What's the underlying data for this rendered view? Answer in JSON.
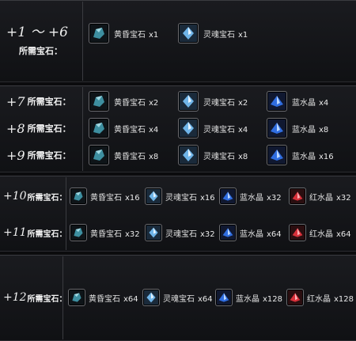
{
  "gem_names": {
    "huanghun": "黄昏宝石",
    "linghun": "灵魂宝石",
    "lanshuijing": "蓝水晶",
    "hongshuijing": "红水晶"
  },
  "colors": {
    "huanghun": "#3d8fa0",
    "linghun": "#6fb4e8",
    "lanshuijing": "#2f6de0",
    "hongshuijing": "#d8303a"
  },
  "section1": {
    "level": "+1 ～ +6",
    "req": "所需宝石："
  },
  "section1_items": [
    {
      "name": "黄昏宝石",
      "qty": "x1"
    },
    {
      "name": "灵魂宝石",
      "qty": "x1"
    }
  ],
  "section2": [
    {
      "level": "+7",
      "req": "所需宝石：",
      "items": [
        {
          "name": "黄昏宝石",
          "qty": "x2"
        },
        {
          "name": "灵魂宝石",
          "qty": "x2"
        },
        {
          "name": "蓝水晶",
          "qty": "x4"
        }
      ]
    },
    {
      "level": "+8",
      "req": "所需宝石：",
      "items": [
        {
          "name": "黄昏宝石",
          "qty": "x4"
        },
        {
          "name": "灵魂宝石",
          "qty": "x4"
        },
        {
          "name": "蓝水晶",
          "qty": "x8"
        }
      ]
    },
    {
      "level": "+9",
      "req": "所需宝石：",
      "items": [
        {
          "name": "黄昏宝石",
          "qty": "x8"
        },
        {
          "name": "灵魂宝石",
          "qty": "x8"
        },
        {
          "name": "蓝水晶",
          "qty": "x16"
        }
      ]
    }
  ],
  "section3": [
    {
      "level": "+10",
      "req": "所需宝石：",
      "items": [
        {
          "name": "黄昏宝石",
          "qty": "x16"
        },
        {
          "name": "灵魂宝石",
          "qty": "x16"
        },
        {
          "name": "蓝水晶",
          "qty": "x32"
        },
        {
          "name": "红水晶",
          "qty": "x32"
        }
      ]
    },
    {
      "level": "+11",
      "req": "所需宝石：",
      "items": [
        {
          "name": "黄昏宝石",
          "qty": "x32"
        },
        {
          "name": "灵魂宝石",
          "qty": "x32"
        },
        {
          "name": "蓝水晶",
          "qty": "x64"
        },
        {
          "name": "红水晶",
          "qty": "x64"
        }
      ]
    }
  ],
  "section4": [
    {
      "level": "+12",
      "req": "所需宝石：",
      "items": [
        {
          "name": "黄昏宝石",
          "qty": "x64"
        },
        {
          "name": "灵魂宝石",
          "qty": "x64"
        },
        {
          "name": "蓝水晶",
          "qty": "x128"
        },
        {
          "name": "红水晶",
          "qty": "x128"
        }
      ]
    }
  ]
}
